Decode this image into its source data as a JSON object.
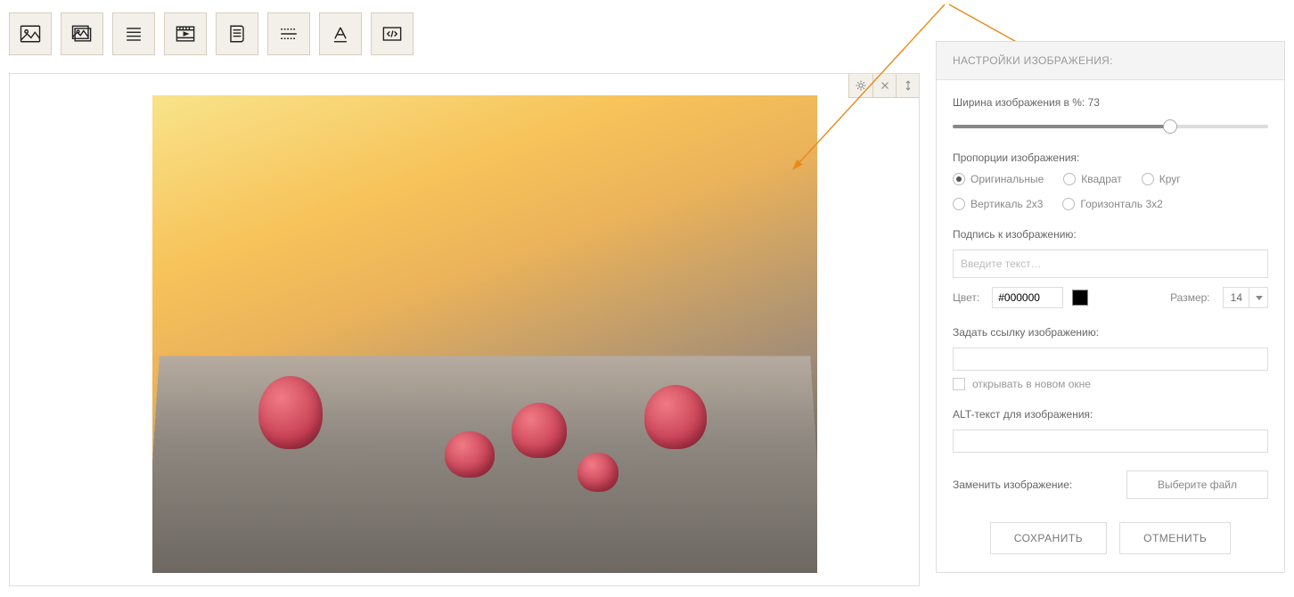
{
  "toolbar": {
    "tools": [
      "image",
      "gallery",
      "text-align",
      "video",
      "document",
      "divider",
      "heading",
      "code"
    ]
  },
  "canvas_tools": [
    "gear",
    "close",
    "move-vertical"
  ],
  "panel": {
    "title": "НАСТРОЙКИ ИЗОБРАЖЕНИЯ:",
    "width_label_prefix": "Ширина изображения в %:",
    "width_value": "73",
    "proportions_label": "Пропорции изображения:",
    "proportions": [
      {
        "value": "original",
        "label": "Оригинальные",
        "selected": true
      },
      {
        "value": "square",
        "label": "Квадрат",
        "selected": false
      },
      {
        "value": "circle",
        "label": "Круг",
        "selected": false
      },
      {
        "value": "v2x3",
        "label": "Вертикаль 2x3",
        "selected": false
      },
      {
        "value": "h3x2",
        "label": "Горизонталь 3x2",
        "selected": false
      }
    ],
    "caption_label": "Подпись к изображению:",
    "caption_placeholder": "Введите текст…",
    "color_label": "Цвет:",
    "color_value": "#000000",
    "size_label": "Размер:",
    "size_value": "14",
    "link_label": "Задать ссылку изображению:",
    "link_value": "",
    "new_window_label": "открывать в новом окне",
    "alt_label": "ALT-текст для изображения:",
    "alt_value": "",
    "replace_label": "Заменить изображение:",
    "file_button": "Выберите файл",
    "save": "СОХРАНИТЬ",
    "cancel": "ОТМЕНИТЬ"
  }
}
